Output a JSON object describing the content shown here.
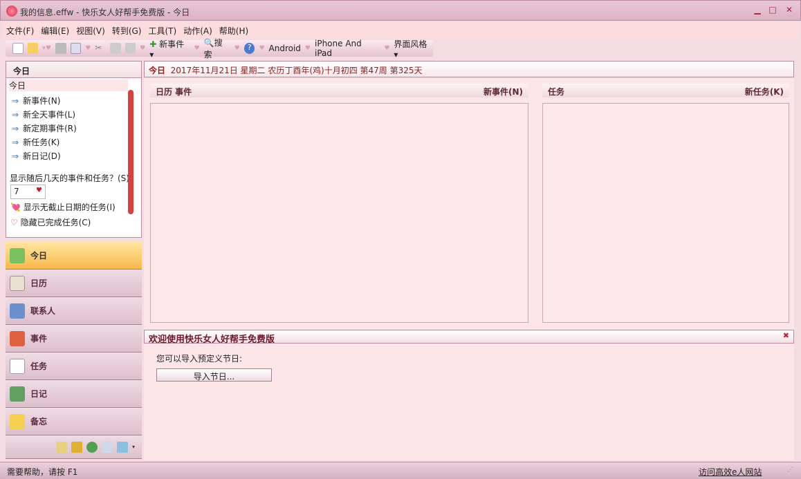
{
  "window": {
    "title": "我的信息.effw - 快乐女人好帮手免费版 - 今日",
    "min": "▁",
    "max": "□",
    "close": "✕"
  },
  "menu": [
    "文件(F)",
    "编辑(E)",
    "视图(V)",
    "转到(G)",
    "工具(T)",
    "动作(A)",
    "帮助(H)"
  ],
  "toolbar": {
    "new_event": "新事件",
    "search": "搜索",
    "android": "Android",
    "iphone": "iPhone And iPad",
    "theme": "界面风格"
  },
  "left": {
    "header": "今日",
    "today": "今日",
    "actions": [
      "新事件(N)",
      "新全天事件(L)",
      "新定期事件(R)",
      "新任务(K)",
      "新日记(D)"
    ],
    "show_days_label": "显示随后几天的事件和任务？(S)",
    "days_value": "7",
    "show_no_deadline": "显示无截止日期的任务(I)",
    "hide_completed": "隐藏已完成任务(C)"
  },
  "nav": [
    "今日",
    "日历",
    "联系人",
    "事件",
    "任务",
    "日记",
    "备忘"
  ],
  "today_bar": {
    "label": "今日",
    "date": "2017年11月21日 星期二 农历丁酉年(鸡)十月初四  第47周 第325天"
  },
  "calendar_col": {
    "title": "日历  事件",
    "new": "新事件(N)"
  },
  "task_col": {
    "title": "任务",
    "new": "新任务(K)"
  },
  "welcome": {
    "title": "欢迎使用快乐女人好帮手免费版",
    "text": "您可以导入预定义节日:",
    "button": "导入节日..."
  },
  "status": {
    "help": "需要帮助，请按 F1",
    "link": "访问高效e人网站"
  }
}
